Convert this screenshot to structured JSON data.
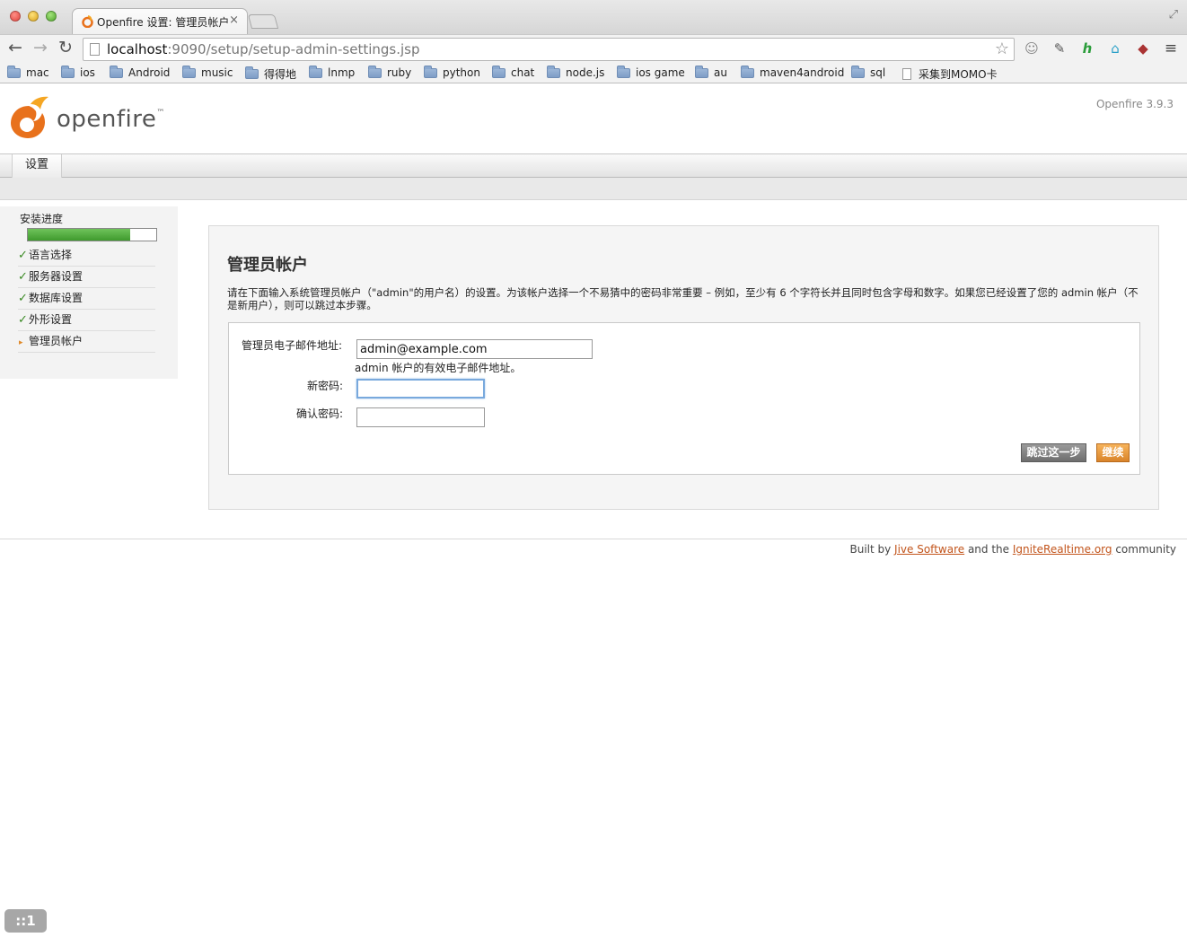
{
  "browser": {
    "tab_title": "Openfire 设置: 管理员帐户",
    "tab_close": "×",
    "url_host": "localhost",
    "url_rest": ":9090/setup/setup-admin-settings.jsp",
    "icons": [
      "back-arrow-icon",
      "forward-arrow-icon",
      "reload-icon",
      "star-icon",
      "extension-icons",
      "menu-icon"
    ],
    "bookmarks": [
      "mac",
      "ios",
      "Android",
      "music",
      "得得地",
      "lnmp",
      "ruby",
      "python",
      "chat",
      "node.js",
      "ios game",
      "au",
      "maven4android",
      "sql",
      "采集到MOMO卡"
    ]
  },
  "header": {
    "logo_text": "openfire",
    "logo_tm": "™",
    "version": "Openfire 3.9.3"
  },
  "nav": {
    "tab_settings": "设置"
  },
  "sidebar": {
    "title": "安装进度",
    "progress": 0.8,
    "steps": [
      {
        "label": "语言选择",
        "done": true
      },
      {
        "label": "服务器设置",
        "done": true
      },
      {
        "label": "数据库设置",
        "done": true
      },
      {
        "label": "外形设置",
        "done": true
      },
      {
        "label": "管理员帐户",
        "done": false,
        "current": true
      }
    ],
    "check": "✓",
    "arrow": "▸"
  },
  "main": {
    "title": "管理员帐户",
    "description": "请在下面输入系统管理员帐户（\"admin\"的用户名）的设置。为该帐户选择一个不易猜中的密码非常重要 – 例如，至少有 6 个字符长并且同时包含字母和数字。如果您已经设置了您的 admin 帐户（不是新用户），则可以跳过本步骤。",
    "email_label": "管理员电子邮件地址:",
    "email_value": "admin@example.com",
    "email_hint": "admin 帐户的有效电子邮件地址。",
    "new_password_label": "新密码:",
    "new_password_value": "",
    "confirm_password_label": "确认密码:",
    "confirm_password_value": "",
    "skip_button": "跳过这一步",
    "continue_button": "继续"
  },
  "footer": {
    "prefix": "Built by ",
    "link1": "Jive Software",
    "middle": " and the ",
    "link2": "IgniteRealtime.org",
    "suffix": " community"
  },
  "status_badge": "::1",
  "colors": {
    "accent": "#d9842a",
    "progress": "#4ea52b",
    "link": "#c2541b"
  }
}
